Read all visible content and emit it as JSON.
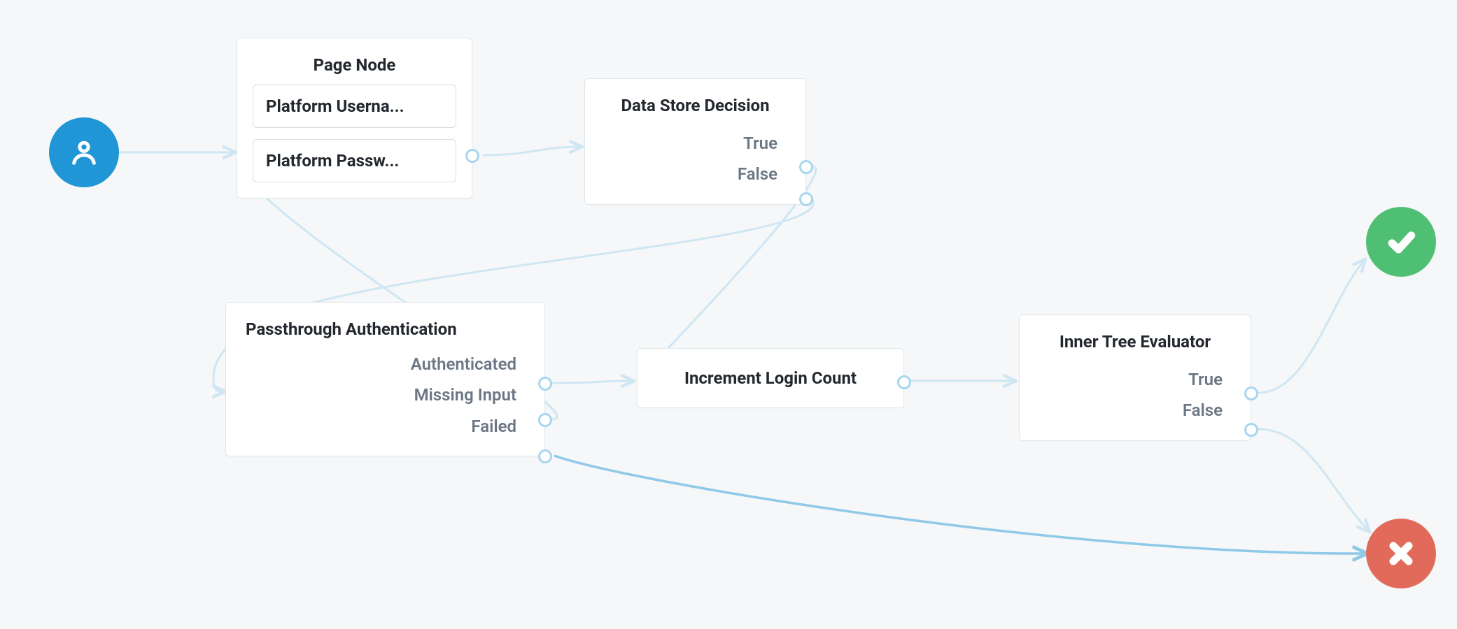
{
  "start": {
    "kind": "user"
  },
  "pageNode": {
    "title": "Page Node",
    "fields": [
      "Platform Userna...",
      "Platform Passw..."
    ]
  },
  "dataStore": {
    "title": "Data Store Decision",
    "outcomes": [
      "True",
      "False"
    ]
  },
  "passthrough": {
    "title": "Passthrough Authentication",
    "outcomes": [
      "Authenticated",
      "Missing Input",
      "Failed"
    ]
  },
  "increment": {
    "title": "Increment Login Count"
  },
  "innerTree": {
    "title": "Inner Tree Evaluator",
    "outcomes": [
      "True",
      "False"
    ]
  },
  "success": {
    "kind": "check"
  },
  "failure": {
    "kind": "cross"
  },
  "colors": {
    "wire": "#cfe6f3",
    "wireStrong": "#8fc9e8",
    "portRing": "#a9d6ef",
    "start": "#2196d6",
    "ok": "#4fbf74",
    "fail": "#e26a5a"
  }
}
